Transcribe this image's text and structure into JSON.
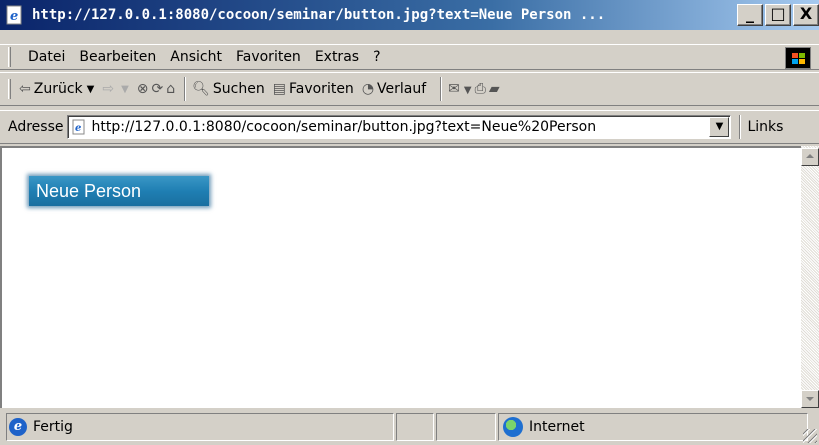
{
  "window": {
    "title": "http://127.0.0.1:8080/cocoon/seminar/button.jpg?text=Neue Person ...",
    "minimize": "_",
    "maximize": "□",
    "close": "X"
  },
  "menu": {
    "items": [
      {
        "label": "Datei"
      },
      {
        "label": "Bearbeiten"
      },
      {
        "label": "Ansicht"
      },
      {
        "label": "Favoriten"
      },
      {
        "label": "Extras"
      },
      {
        "label": "?"
      }
    ]
  },
  "toolbar": {
    "back": "Zurück",
    "search": "Suchen",
    "favorites": "Favoriten",
    "history": "Verlauf"
  },
  "address": {
    "label": "Adresse",
    "url": "http://127.0.0.1:8080/cocoon/seminar/button.jpg?text=Neue%20Person",
    "links": "Links"
  },
  "content": {
    "button_label": "Neue Person",
    "button_color": "#1f7fb3"
  },
  "status": {
    "text": "Fertig",
    "zone": "Internet"
  }
}
